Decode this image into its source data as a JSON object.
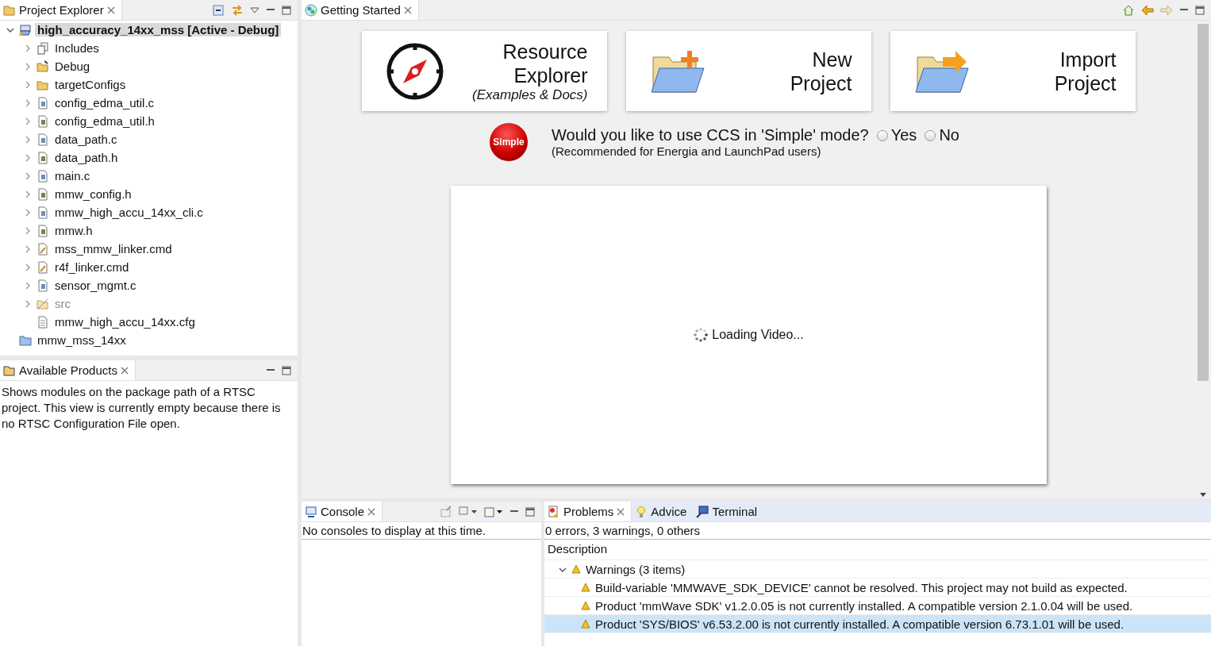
{
  "project_explorer": {
    "tab": {
      "label": "Project Explorer",
      "selected": true
    },
    "tree": [
      {
        "label": "high_accuracy_14xx_mss  [Active - Debug]",
        "kind": "project",
        "expanded": true,
        "selected": true,
        "children": [
          {
            "label": "Includes",
            "kind": "includes",
            "expanded": false
          },
          {
            "label": "Debug",
            "kind": "debug",
            "expanded": false
          },
          {
            "label": "targetConfigs",
            "kind": "folder",
            "expanded": false
          },
          {
            "label": "config_edma_util.c",
            "kind": "c",
            "expanded": false
          },
          {
            "label": "config_edma_util.h",
            "kind": "h",
            "expanded": false
          },
          {
            "label": "data_path.c",
            "kind": "c",
            "expanded": false
          },
          {
            "label": "data_path.h",
            "kind": "h",
            "expanded": false
          },
          {
            "label": "main.c",
            "kind": "c",
            "expanded": false
          },
          {
            "label": "mmw_config.h",
            "kind": "h",
            "expanded": false
          },
          {
            "label": "mmw_high_accu_14xx_cli.c",
            "kind": "c",
            "expanded": false
          },
          {
            "label": "mmw.h",
            "kind": "h",
            "expanded": false
          },
          {
            "label": "mss_mmw_linker.cmd",
            "kind": "cmd",
            "expanded": false
          },
          {
            "label": "r4f_linker.cmd",
            "kind": "cmd",
            "expanded": false
          },
          {
            "label": "sensor_mgmt.c",
            "kind": "c",
            "expanded": false
          },
          {
            "label": "src",
            "kind": "src",
            "expanded": false,
            "disabled": true
          },
          {
            "label": "mmw_high_accu_14xx.cfg",
            "kind": "cfg"
          }
        ]
      },
      {
        "label": "mmw_mss_14xx",
        "kind": "closed",
        "selected": false
      }
    ]
  },
  "available_products": {
    "tab": {
      "label": "Available Products",
      "selected": true
    },
    "message": "Shows modules on the package path of a RTSC project. This view is currently empty because there is no RTSC Configuration File open."
  },
  "getting_started": {
    "tab": {
      "label": "Getting Started",
      "selected": true
    },
    "cards": [
      {
        "kind": "compass",
        "lines": [
          "Resource",
          "Explorer"
        ],
        "note": "(Examples & Docs)"
      },
      {
        "kind": "new",
        "lines": [
          "New",
          "Project"
        ]
      },
      {
        "kind": "import",
        "lines": [
          "Import",
          "Project"
        ]
      }
    ],
    "simple_badge": "Simple",
    "question": "Would you like to use CCS in 'Simple' mode?",
    "hint": "(Recommended for Energia and LaunchPad users)",
    "options": [
      {
        "label": "Yes",
        "selected": false
      },
      {
        "label": "No",
        "selected": false
      }
    ],
    "video": {
      "status": "Loading Video..."
    }
  },
  "console": {
    "tab": {
      "label": "Console",
      "selected": true
    },
    "message": "No consoles to display at this time."
  },
  "problems": {
    "tabs": [
      {
        "label": "Problems",
        "kind": "problems",
        "selected": true
      },
      {
        "label": "Advice",
        "kind": "advice",
        "selected": false
      },
      {
        "label": "Terminal",
        "kind": "terminal",
        "selected": false
      }
    ],
    "summary": "0 errors, 3 warnings, 0 others",
    "column": "Description",
    "groups": [
      {
        "label": "Warnings (3 items)",
        "expanded": true,
        "items": [
          {
            "text": "Build-variable 'MMWAVE_SDK_DEVICE' cannot be resolved. This project may not build as expected.",
            "selected": false
          },
          {
            "text": "Product 'mmWave SDK' v1.2.0.05 is not currently installed. A compatible version 2.1.0.04 will be used.",
            "selected": false
          },
          {
            "text": "Product 'SYS/BIOS' v6.53.2.00 is not currently installed. A compatible version 6.73.1.01 will be used.",
            "selected": true
          }
        ]
      }
    ]
  }
}
